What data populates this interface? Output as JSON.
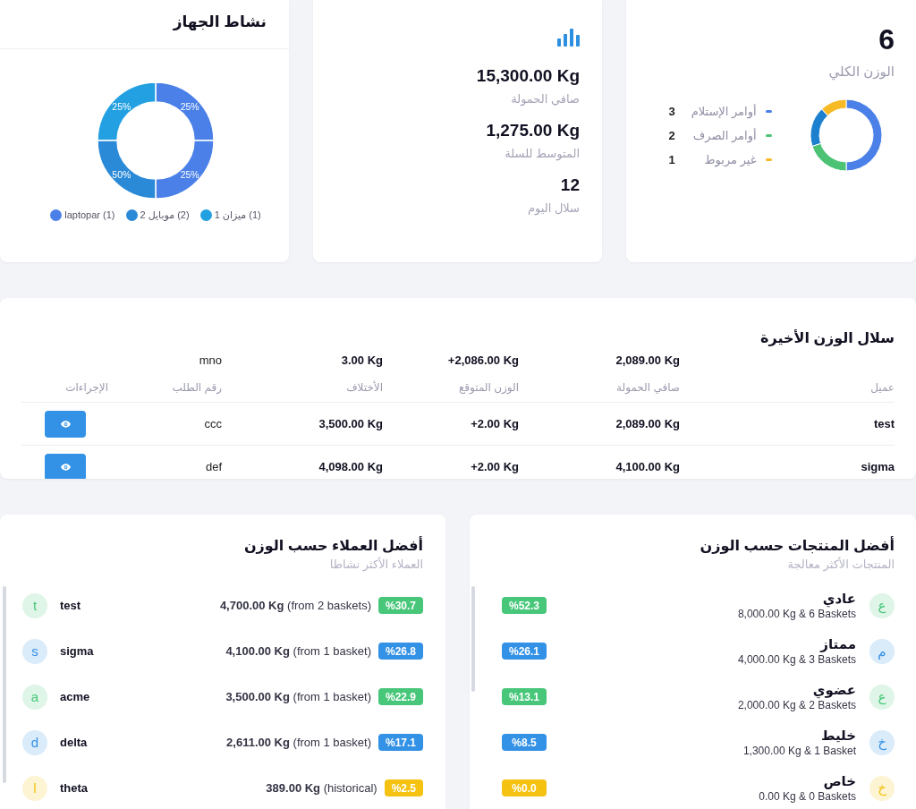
{
  "total_weight": {
    "value": "6",
    "label": "الوزن الكلي",
    "legend": [
      {
        "label": "أوامر الإستلام",
        "count": "3",
        "color": "#4a80e8"
      },
      {
        "label": "أوامر الصرف",
        "count": "2",
        "color": "#4cc374"
      },
      {
        "label": "غير مربوط",
        "count": "1",
        "color": "#f7b924"
      }
    ]
  },
  "stats": {
    "items": [
      {
        "value": "15,300.00 Kg",
        "label": "صافي الحمولة"
      },
      {
        "value": "1,275.00 Kg",
        "label": "المتوسط للسلة"
      },
      {
        "value": "12",
        "label": "سلال اليوم"
      }
    ]
  },
  "device_activity": {
    "title": "نشاط الجهاز",
    "slices": [
      {
        "label": "25%",
        "color": "#4a80e8"
      },
      {
        "label": "25%",
        "color": "#23a0e2"
      },
      {
        "label": "25%",
        "color": "#4a80e8"
      },
      {
        "label": "50%",
        "color": "#2b8ad8"
      }
    ],
    "legend": [
      {
        "name": "ميزان 1",
        "count": "(1)",
        "color": "#23a0e2"
      },
      {
        "name": "موبايل 2",
        "count": "(2)",
        "color": "#2b8ad8"
      },
      {
        "name": "laptopar",
        "count": "(1)",
        "color": "#4a80e8"
      }
    ]
  },
  "recent_baskets": {
    "title": "سلال الوزن الأخيرة",
    "top_row": {
      "net": "2,089.00 Kg",
      "expected": "+2,086.00 Kg",
      "difference": "3.00 Kg",
      "order": "mno"
    },
    "columns": [
      "عميل",
      "صافي الحمولة",
      "الوزن المتوقع",
      "الأختلاف",
      "رقم الطلب",
      "الإجراءات"
    ],
    "rows": [
      {
        "client": "test",
        "net": "2,089.00 Kg",
        "expected": "+2.00 Kg",
        "difference": "3,500.00 Kg",
        "order": "ccc"
      },
      {
        "client": "sigma",
        "net": "4,100.00 Kg",
        "expected": "+2.00 Kg",
        "difference": "4,098.00 Kg",
        "order": "def"
      }
    ]
  },
  "top_products": {
    "title": "أفضل المنتجات حسب الوزن",
    "subtitle": "المنتجات الأكثر معالجة",
    "items": [
      {
        "initial": "ع",
        "name": "عادي",
        "detail": "8,000.00 Kg & 6 Baskets",
        "share": "%52.3",
        "color": "#48c77a"
      },
      {
        "initial": "م",
        "name": "ممتاز",
        "detail": "4,000.00 Kg & 3 Baskets",
        "share": "%26.1",
        "color": "#3391e6"
      },
      {
        "initial": "ع",
        "name": "عضوي",
        "detail": "2,000.00 Kg & 2 Baskets",
        "share": "%13.1",
        "color": "#48c77a"
      },
      {
        "initial": "خ",
        "name": "خليط",
        "detail": "1,300.00 Kg & 1 Basket",
        "share": "%8.5",
        "color": "#3391e6"
      },
      {
        "initial": "خ",
        "name": "خاص",
        "detail": "0.00 Kg & 0 Baskets",
        "share": "%0.0",
        "color": "#f5c211"
      }
    ]
  },
  "top_customers": {
    "title": "أفضل العملاء حسب الوزن",
    "subtitle": "العملاء الأكثر نشاطا",
    "items": [
      {
        "initial": "t",
        "name": "test",
        "weight": "**4,700.00 Kg** (from 2 baskets)",
        "share": "%30.7",
        "color": "#48c77a"
      },
      {
        "initial": "s",
        "name": "sigma",
        "weight": "**4,100.00 Kg** (from 1 basket)",
        "share": "%26.8",
        "color": "#3391e6"
      },
      {
        "initial": "a",
        "name": "acme",
        "weight": "**3,500.00 Kg** (from 1 basket)",
        "share": "%22.9",
        "color": "#48c77a"
      },
      {
        "initial": "d",
        "name": "delta",
        "weight": "**2,611.00 Kg** (from 1 basket)",
        "share": "%17.1",
        "color": "#3391e6"
      },
      {
        "initial": "l",
        "name": "theta",
        "weight": "**389.00 Kg** (historical)",
        "share": "%2.5",
        "color": "#f5c211"
      }
    ]
  }
}
